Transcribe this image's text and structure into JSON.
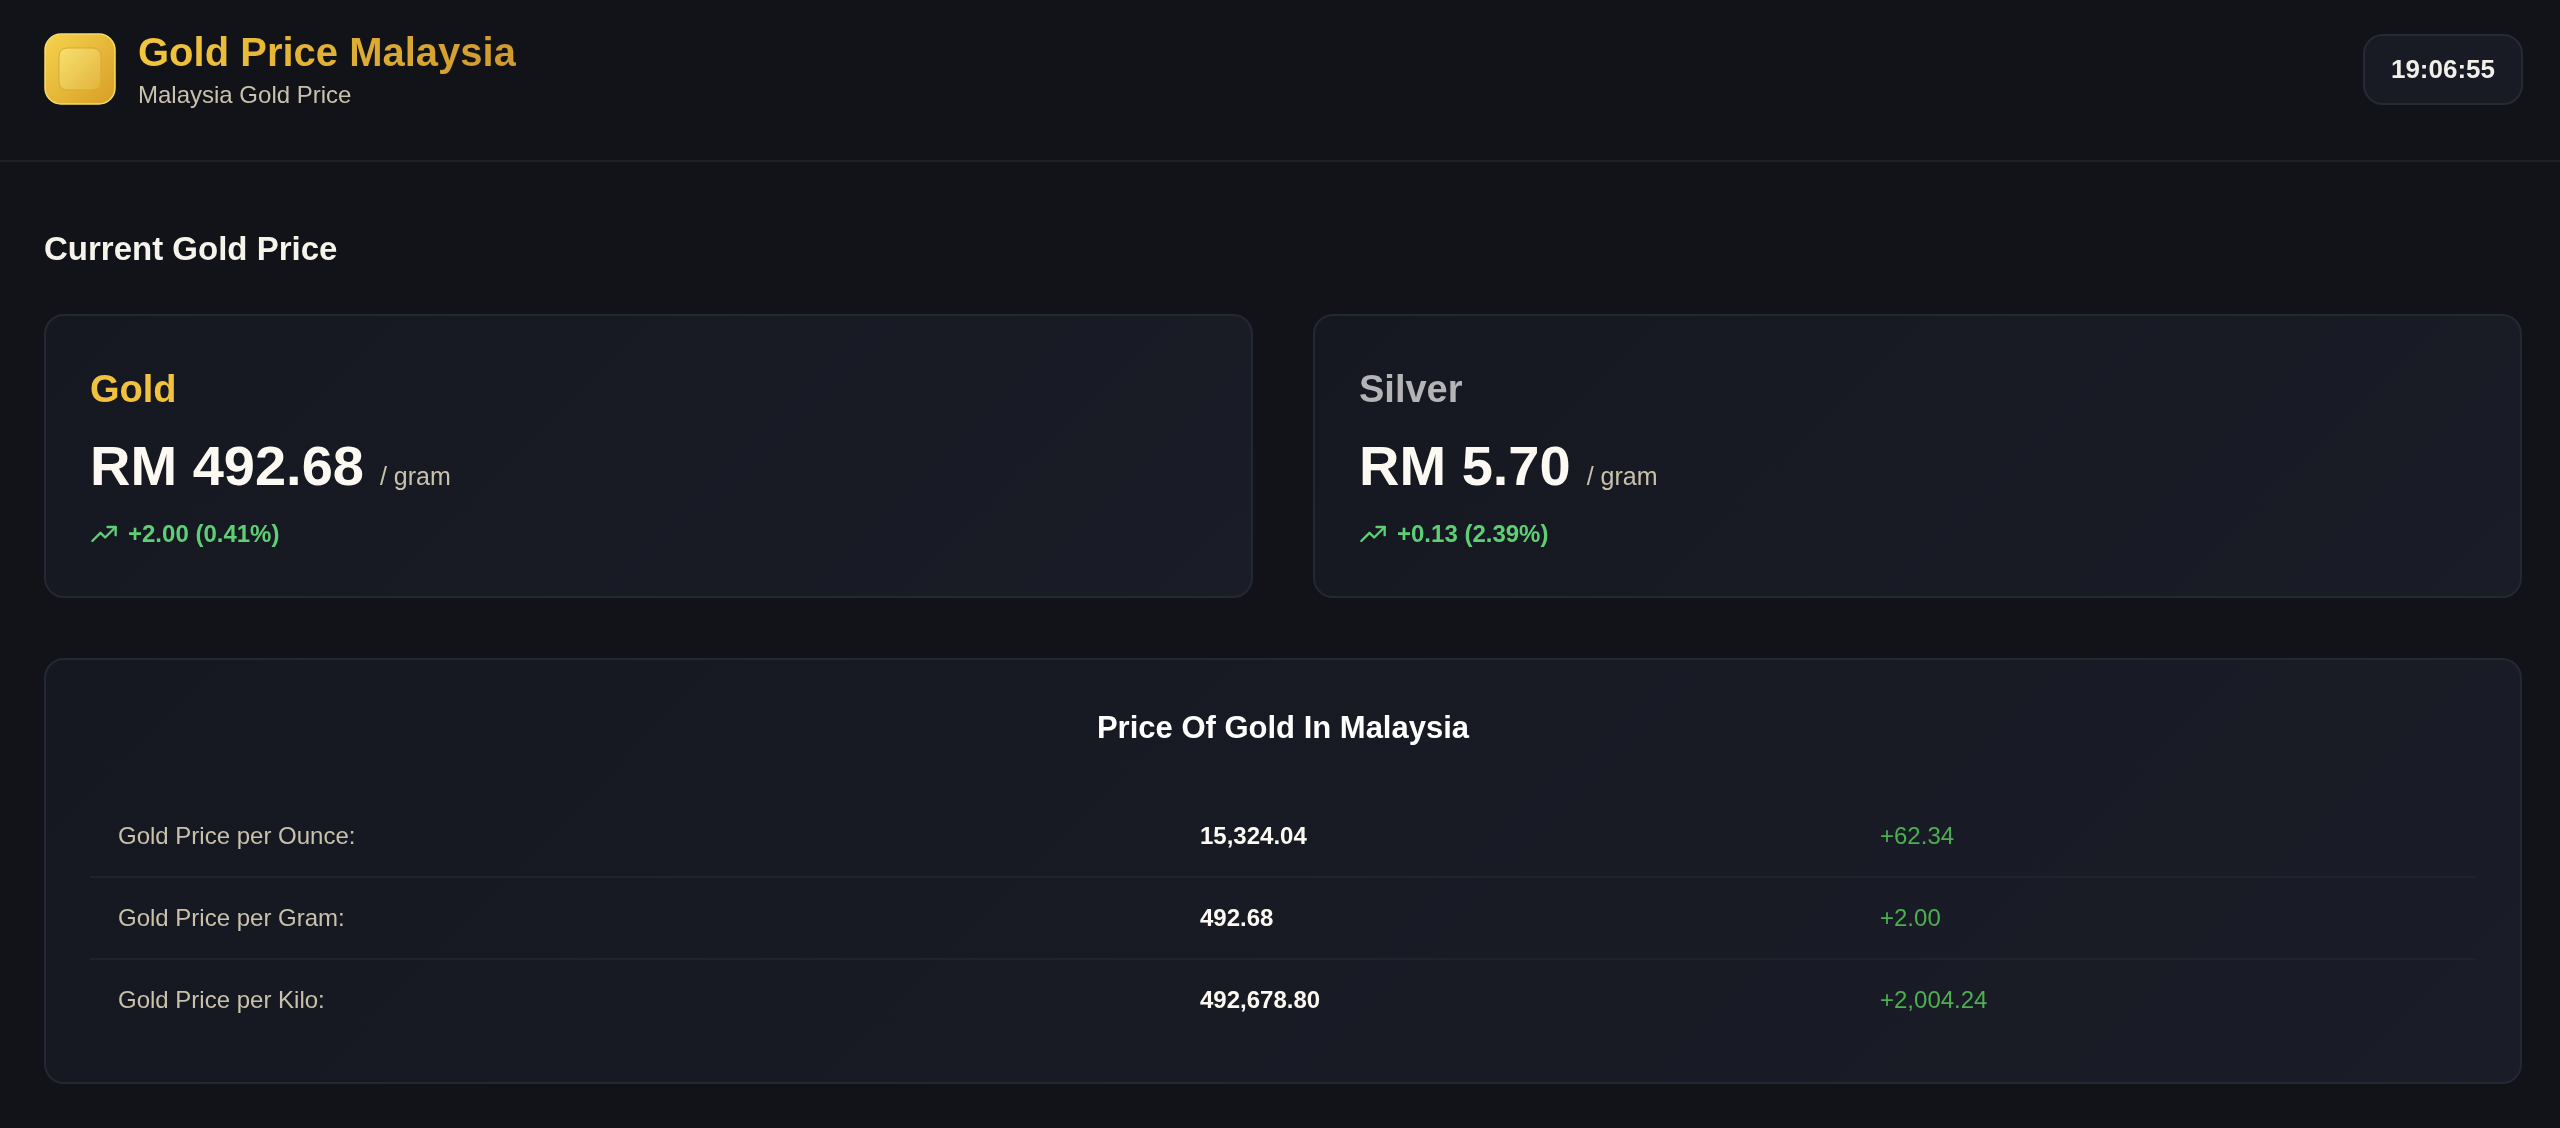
{
  "header": {
    "title": "Gold Price Malaysia",
    "subtitle": "Malaysia Gold Price",
    "clock": "19:06:55"
  },
  "section_title": "Current Gold Price",
  "metals": [
    {
      "name": "Gold",
      "kind": "gold",
      "price": "RM 492.68",
      "unit": "/ gram",
      "change": {
        "kind": "up",
        "text": "+2.00 (0.41%)"
      }
    },
    {
      "name": "Silver",
      "kind": "silver",
      "price": "RM 5.70",
      "unit": "/ gram",
      "change": {
        "kind": "up",
        "text": "+0.13 (2.39%)"
      }
    }
  ],
  "table": {
    "title": "Price Of Gold In Malaysia",
    "rows": [
      {
        "label": "Gold Price per Ounce:",
        "value": "15,324.04",
        "kind": "up",
        "change": "+62.34"
      },
      {
        "label": "Gold Price per Gram:",
        "value": "492.68",
        "kind": "up",
        "change": "+2.00"
      },
      {
        "label": "Gold Price per Kilo:",
        "value": "492,678.80",
        "kind": "up",
        "change": "+2,004.24"
      }
    ]
  }
}
